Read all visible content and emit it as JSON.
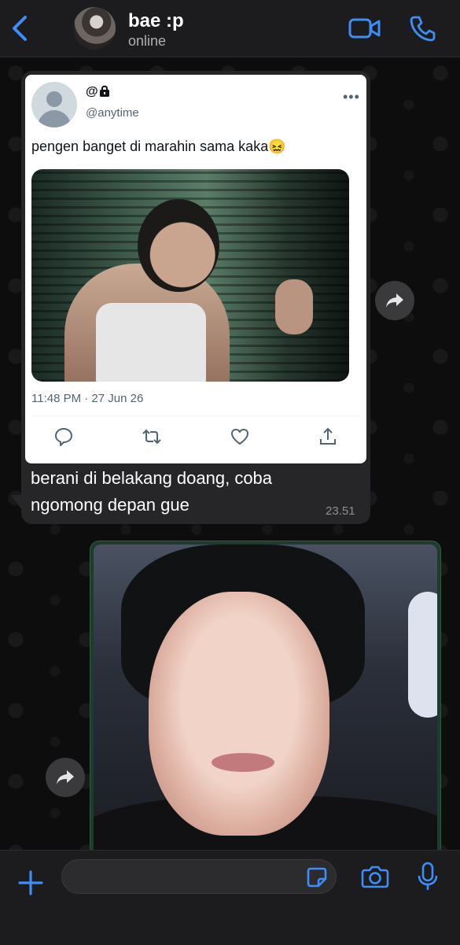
{
  "header": {
    "contact_name": "bae :p",
    "status": "online",
    "accent_color": "#3e8ef7"
  },
  "messages": [
    {
      "direction": "incoming",
      "shared_tweet": {
        "display_name": "@",
        "protected_icon": "lock-icon",
        "handle": "@anytime",
        "text": "pengen banget di marahin sama kaka😖",
        "timestamp": "11:48 PM · 27 Jun 26",
        "actions": [
          "reply-icon",
          "retweet-icon",
          "like-icon",
          "share-icon"
        ]
      },
      "text": "berani di belakang doang, coba ngomong depan gue",
      "time": "23.51"
    },
    {
      "direction": "outgoing",
      "type": "photo"
    }
  ],
  "input": {
    "placeholder": ""
  }
}
